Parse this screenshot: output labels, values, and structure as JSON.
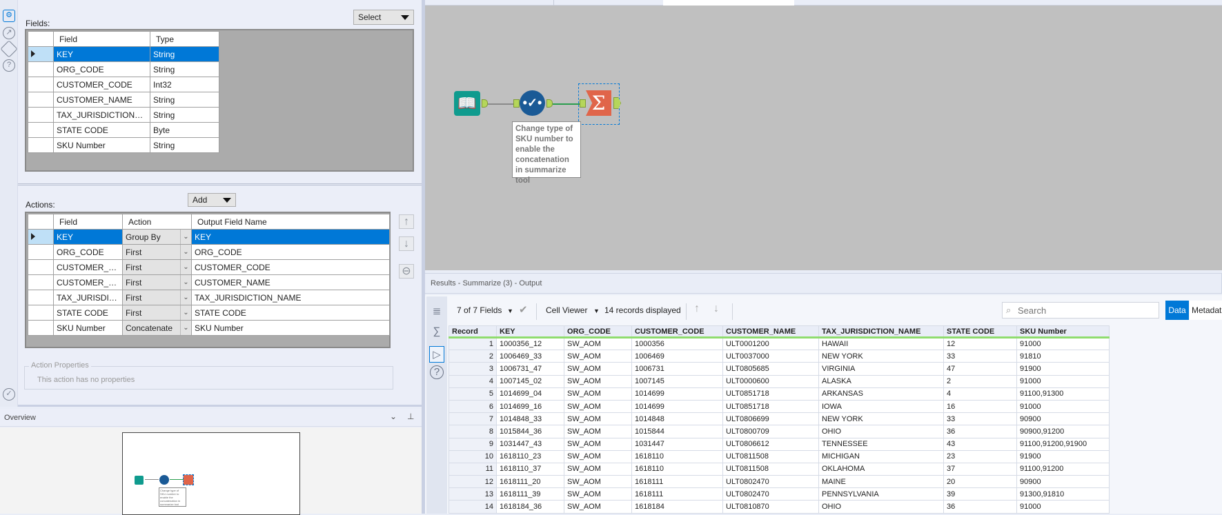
{
  "config": {
    "fields_label": "Fields:",
    "select_dropdown": "Select",
    "fields_headers": [
      "Field",
      "Type"
    ],
    "fields": [
      {
        "field": "KEY",
        "type": "String"
      },
      {
        "field": "ORG_CODE",
        "type": "String"
      },
      {
        "field": "CUSTOMER_CODE",
        "type": "Int32"
      },
      {
        "field": "CUSTOMER_NAME",
        "type": "String"
      },
      {
        "field": "TAX_JURISDICTION_NAME",
        "type": "String"
      },
      {
        "field": "STATE CODE",
        "type": "Byte"
      },
      {
        "field": "SKU Number",
        "type": "String"
      }
    ],
    "actions_label": "Actions:",
    "add_dropdown": "Add",
    "actions_headers": [
      "Field",
      "Action",
      "Output Field Name"
    ],
    "actions": [
      {
        "field": "KEY",
        "action": "Group By",
        "output": "KEY"
      },
      {
        "field": "ORG_CODE",
        "action": "First",
        "output": "ORG_CODE"
      },
      {
        "field": "CUSTOMER_CO...",
        "action": "First",
        "output": "CUSTOMER_CODE"
      },
      {
        "field": "CUSTOMER_NA...",
        "action": "First",
        "output": "CUSTOMER_NAME"
      },
      {
        "field": "TAX_JURISDICTI...",
        "action": "First",
        "output": "TAX_JURISDICTION_NAME"
      },
      {
        "field": "STATE CODE",
        "action": "First",
        "output": "STATE CODE"
      },
      {
        "field": "SKU Number",
        "action": "Concatenate",
        "output": "SKU Number"
      }
    ],
    "action_properties_title": "Action Properties",
    "action_properties_text": "This action has no properties"
  },
  "overview": {
    "title": "Overview"
  },
  "canvas": {
    "annotation": "Change type of SKU number to enable the concatenation in summarize tool",
    "colors": {
      "input": "#0f9b8e",
      "select": "#1a5a96",
      "summarize": "#e0654a"
    }
  },
  "results": {
    "title": "Results - Summarize (3) - Output",
    "fields_count": "7 of 7 Fields",
    "cell_viewer": "Cell Viewer",
    "records_displayed": "14 records displayed",
    "search_placeholder": "Search",
    "tab_data": "Data",
    "tab_metadata": "Metadata",
    "columns": [
      "Record",
      "KEY",
      "ORG_CODE",
      "CUSTOMER_CODE",
      "CUSTOMER_NAME",
      "TAX_JURISDICTION_NAME",
      "STATE CODE",
      "SKU Number"
    ],
    "rows": [
      [
        "1",
        "1000356_12",
        "SW_AOM",
        "1000356",
        "ULT0001200",
        "HAWAII",
        "12",
        "91000"
      ],
      [
        "2",
        "1006469_33",
        "SW_AOM",
        "1006469",
        "ULT0037000",
        "NEW YORK",
        "33",
        "91810"
      ],
      [
        "3",
        "1006731_47",
        "SW_AOM",
        "1006731",
        "ULT0805685",
        "VIRGINIA",
        "47",
        "91900"
      ],
      [
        "4",
        "1007145_02",
        "SW_AOM",
        "1007145",
        "ULT0000600",
        "ALASKA",
        "2",
        "91000"
      ],
      [
        "5",
        "1014699_04",
        "SW_AOM",
        "1014699",
        "ULT0851718",
        "ARKANSAS",
        "4",
        "91100,91300"
      ],
      [
        "6",
        "1014699_16",
        "SW_AOM",
        "1014699",
        "ULT0851718",
        "IOWA",
        "16",
        "91000"
      ],
      [
        "7",
        "1014848_33",
        "SW_AOM",
        "1014848",
        "ULT0806699",
        "NEW YORK",
        "33",
        "90900"
      ],
      [
        "8",
        "1015844_36",
        "SW_AOM",
        "1015844",
        "ULT0800709",
        "OHIO",
        "36",
        "90900,91200"
      ],
      [
        "9",
        "1031447_43",
        "SW_AOM",
        "1031447",
        "ULT0806612",
        "TENNESSEE",
        "43",
        "91100,91200,91900"
      ],
      [
        "10",
        "1618110_23",
        "SW_AOM",
        "1618110",
        "ULT0811508",
        "MICHIGAN",
        "23",
        "91900"
      ],
      [
        "11",
        "1618110_37",
        "SW_AOM",
        "1618110",
        "ULT0811508",
        "OKLAHOMA",
        "37",
        "91100,91200"
      ],
      [
        "12",
        "1618111_20",
        "SW_AOM",
        "1618111",
        "ULT0802470",
        "MAINE",
        "20",
        "90900"
      ],
      [
        "13",
        "1618111_39",
        "SW_AOM",
        "1618111",
        "ULT0802470",
        "PENNSYLVANIA",
        "39",
        "91300,91810"
      ],
      [
        "14",
        "1618184_36",
        "SW_AOM",
        "1618184",
        "ULT0810870",
        "OHIO",
        "36",
        "91000"
      ]
    ]
  }
}
